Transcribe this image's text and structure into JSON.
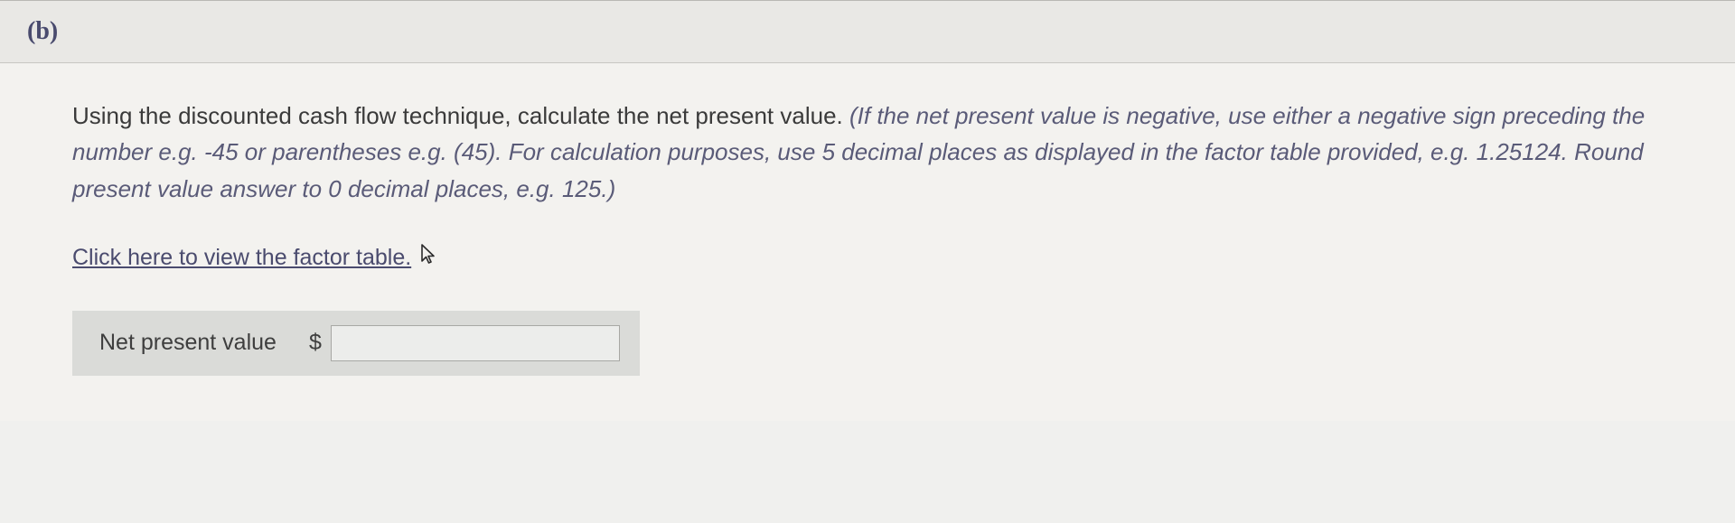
{
  "part": {
    "label": "(b)"
  },
  "question": {
    "lead": "Using the discounted cash flow technique, calculate the net present value. ",
    "hint": "(If the net present value is negative, use either a negative sign preceding the number e.g. -45 or parentheses e.g. (45). For calculation purposes, use 5 decimal places as displayed in the factor table provided, e.g. 1.25124. Round present value answer to 0 decimal places, e.g. 125.)"
  },
  "link": {
    "factor_table": "Click here to view the factor table."
  },
  "answer": {
    "label": "Net present value",
    "currency": "$",
    "value": ""
  },
  "icons": {
    "cursor": "cursor-icon"
  }
}
